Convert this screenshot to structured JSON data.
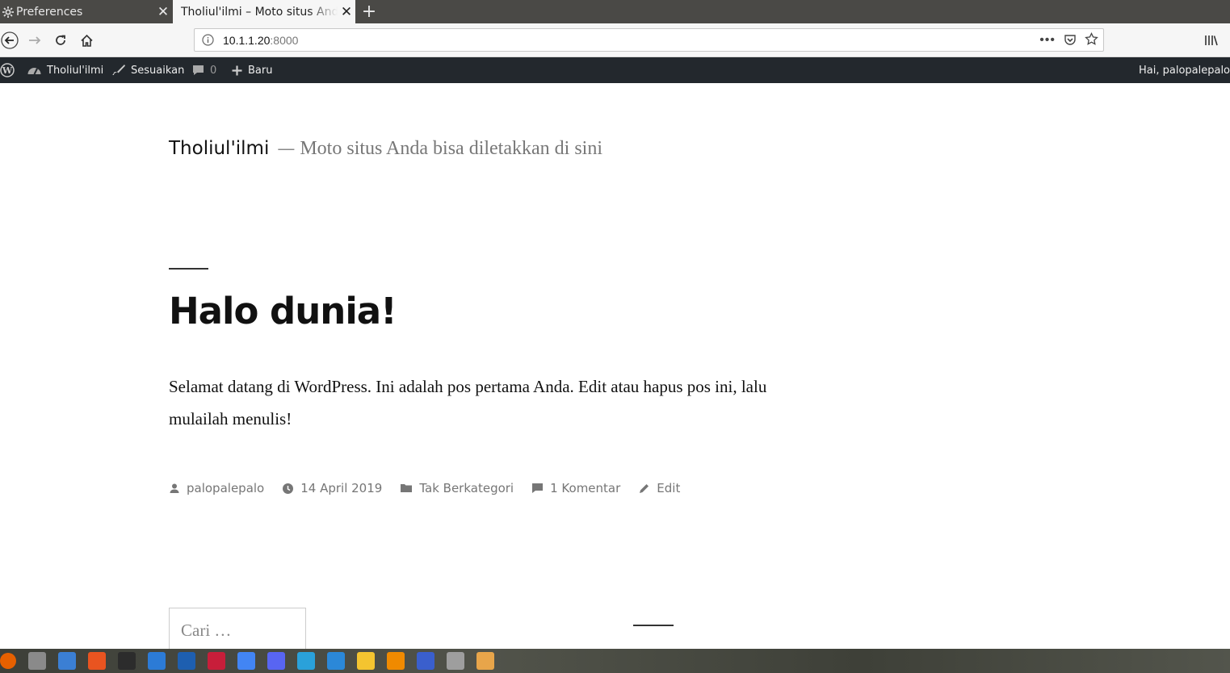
{
  "browser": {
    "tabs": [
      {
        "label": "Preferences",
        "active": false
      },
      {
        "label": "Tholiul'ilmi – Moto situs Anda bisa diletakkan di sini",
        "active": true
      }
    ],
    "new_tab_label": "+",
    "url_host": "10.1.1.20",
    "url_port": ":8000"
  },
  "wp_admin_bar": {
    "site_name": "Tholiul'ilmi",
    "customize": "Sesuaikan",
    "comments_count": "0",
    "new": "Baru",
    "greeting": "Hai, palopalepalo"
  },
  "site": {
    "title": "Tholiul'ilmi",
    "separator": "—",
    "tagline": "Moto situs Anda bisa diletakkan di sini"
  },
  "post": {
    "title": "Halo dunia!",
    "body": "Selamat datang di WordPress. Ini adalah pos pertama Anda. Edit atau hapus pos ini, lalu mulailah menulis!",
    "meta": {
      "author": "palopalepalo",
      "date": "14 April 2019",
      "category": "Tak Berkategori",
      "comments": "1 Komentar",
      "edit": "Edit"
    }
  },
  "search": {
    "placeholder": "Cari …"
  },
  "taskbar": {
    "icons": [
      "firefox-icon",
      "files-icon",
      "document-icon",
      "software-icon",
      "terminal-icon",
      "vscode-icon",
      "filezilla-icon",
      "mendeley-icon",
      "chrome-icon",
      "discord-icon",
      "telegram-icon",
      "monitor-icon",
      "notes-icon",
      "vlc-icon",
      "eclipse-icon",
      "screenshot-icon",
      "text-editor-icon"
    ],
    "colors": [
      "#e66000",
      "#8a8a8a",
      "#3b7fd4",
      "#e95420",
      "#2c2c2c",
      "#2c7bd6",
      "#1e5fb0",
      "#c81e3a",
      "#4285f4",
      "#5865f2",
      "#2aa1da",
      "#2b88d8",
      "#f4c430",
      "#f08a00",
      "#3a5fcd",
      "#9e9e9e",
      "#e8a54a"
    ]
  }
}
